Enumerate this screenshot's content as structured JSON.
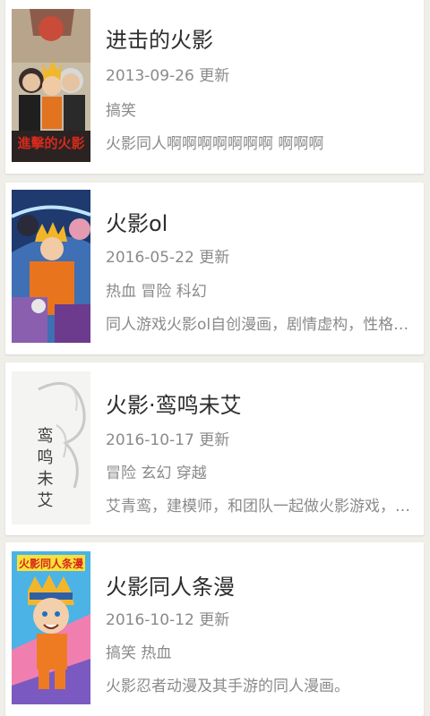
{
  "comics": [
    {
      "title": "进击的火影",
      "updated": "2013-09-26 更新",
      "tags": "搞笑",
      "desc": "火影同人啊啊啊啊啊啊啊 啊啊啊",
      "cover_text": "進擊的火影",
      "cover_icon": "anime-group-cover"
    },
    {
      "title": "火影ol",
      "updated": "2016-05-22 更新",
      "tags": "热血 冒险 科幻",
      "desc": "同人游戏火影ol自创漫画，剧情虚构，性格参照岸本老师原作",
      "cover_icon": "naruto-action-cover"
    },
    {
      "title": "火影·鸾鸣未艾",
      "updated": "2016-10-17 更新",
      "tags": "冒险 玄幻 穿越",
      "desc": "艾青鸾，建模师，和团队一起做火影游戏，而自己辛苦设计的角色",
      "cover_text": "鸾鸣未艾",
      "cover_icon": "calligraphy-dragon-cover"
    },
    {
      "title": "火影同人条漫",
      "updated": "2016-10-12 更新",
      "tags": "搞笑 热血",
      "desc": "火影忍者动漫及其手游的同人漫画。",
      "cover_text": "火影同人条漫",
      "cover_icon": "chibi-naruto-cover"
    }
  ]
}
